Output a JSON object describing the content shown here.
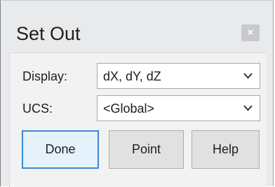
{
  "dialog": {
    "title": "Set Out",
    "close_label": "×"
  },
  "fields": {
    "display": {
      "label": "Display:",
      "value": "dX, dY, dZ"
    },
    "ucs": {
      "label": "UCS:",
      "value": "<Global>"
    }
  },
  "buttons": {
    "done": "Done",
    "point": "Point",
    "help": "Help"
  }
}
